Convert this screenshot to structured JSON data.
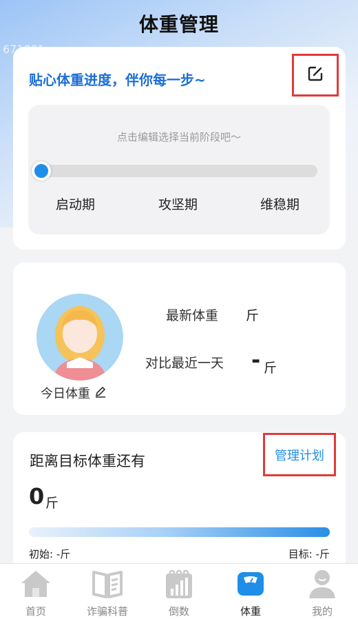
{
  "header": {
    "title": "体重管理",
    "watermark": "671891"
  },
  "progress_card": {
    "heading": "贴心体重进度，伴你每一步~",
    "hint": "点击编辑选择当前阶段吧～",
    "stages": [
      "启动期",
      "攻坚期",
      "维稳期"
    ],
    "stage_progress": 0
  },
  "weight_card": {
    "latest_label": "最新体重",
    "latest_unit": "斤",
    "compare_label": "对比最近一天",
    "compare_value": "-",
    "compare_unit": "斤",
    "today_label": "今日体重"
  },
  "goal_card": {
    "heading": "距离目标体重还有",
    "manage_label": "管理计划",
    "remaining_value": "0",
    "remaining_unit": "斤",
    "start_text": "初始: -斤",
    "target_text": "目标: -斤"
  },
  "tabbar": {
    "items": [
      {
        "label": "首页",
        "icon": "home-icon",
        "active": false
      },
      {
        "label": "诈骗科普",
        "icon": "book-icon",
        "active": false
      },
      {
        "label": "倒数",
        "icon": "calendar-chart-icon",
        "active": false
      },
      {
        "label": "体重",
        "icon": "scale-icon",
        "active": true
      },
      {
        "label": "我的",
        "icon": "person-icon",
        "active": false
      }
    ]
  },
  "colors": {
    "accent": "#1e8ee8",
    "heading_blue": "#1c6fd6",
    "highlight_red": "#e03a3a"
  }
}
